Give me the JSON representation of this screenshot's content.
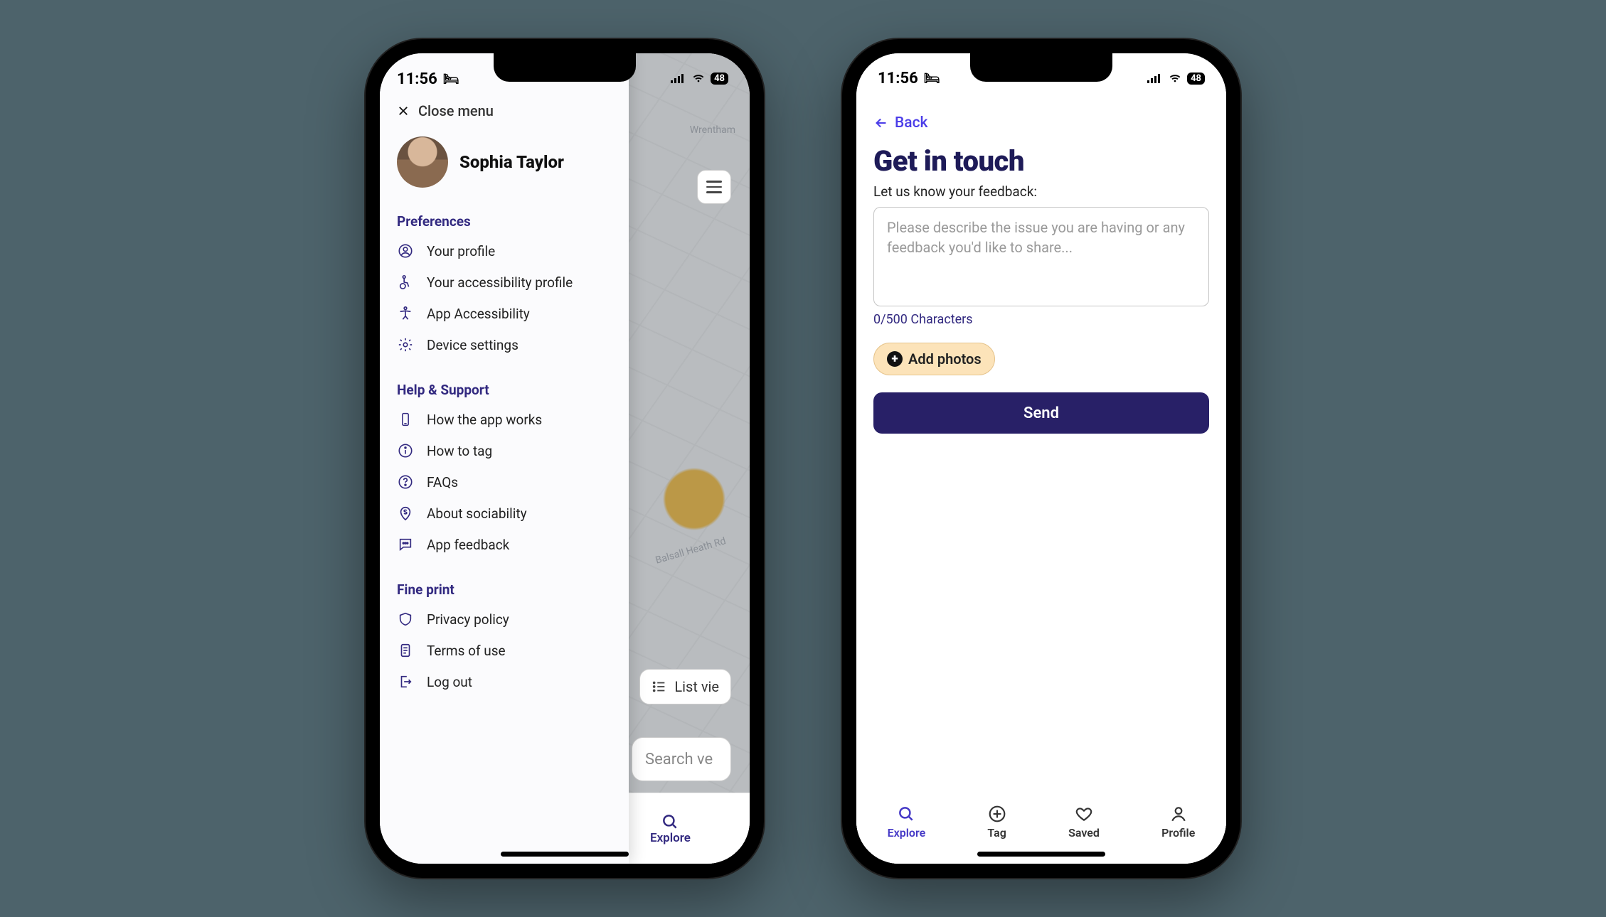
{
  "status": {
    "time": "11:56",
    "battery": "48"
  },
  "drawer": {
    "close_label": "Close menu",
    "user_name": "Sophia Taylor",
    "sections": {
      "preferences": {
        "title": "Preferences",
        "items": [
          {
            "icon": "user-circle-icon",
            "label": "Your profile"
          },
          {
            "icon": "wheelchair-icon",
            "label": "Your accessibility profile"
          },
          {
            "icon": "accessibility-person-icon",
            "label": "App Accessibility"
          },
          {
            "icon": "gear-icon",
            "label": "Device settings"
          }
        ]
      },
      "help": {
        "title": "Help & Support",
        "items": [
          {
            "icon": "phone-icon",
            "label": "How the app works"
          },
          {
            "icon": "info-icon",
            "label": "How to tag"
          },
          {
            "icon": "question-icon",
            "label": "FAQs"
          },
          {
            "icon": "location-s-icon",
            "label": "About sociability"
          },
          {
            "icon": "chat-icon",
            "label": "App feedback"
          }
        ]
      },
      "fineprint": {
        "title": "Fine print",
        "items": [
          {
            "icon": "shield-icon",
            "label": "Privacy policy"
          },
          {
            "icon": "document-icon",
            "label": "Terms of use"
          },
          {
            "icon": "logout-icon",
            "label": "Log out"
          }
        ]
      }
    }
  },
  "map_layer": {
    "list_view_label": "List vie",
    "search_placeholder": "Search ve",
    "street_labels": [
      "Wrentham",
      "Balsall Heath Rd"
    ],
    "nav_explore_label": "Explore"
  },
  "feedback": {
    "back_label": "Back",
    "title": "Get in touch",
    "subtitle": "Let us know your feedback:",
    "placeholder": "Please describe the issue you are having or any feedback you'd like to share...",
    "char_count": "0/500 Characters",
    "add_photos_label": "Add photos",
    "send_label": "Send"
  },
  "bottom_nav": {
    "items": [
      {
        "icon": "search-icon",
        "label": "Explore",
        "active": true
      },
      {
        "icon": "plus-circle-icon",
        "label": "Tag",
        "active": false
      },
      {
        "icon": "heart-icon",
        "label": "Saved",
        "active": false
      },
      {
        "icon": "profile-icon",
        "label": "Profile",
        "active": false
      }
    ]
  }
}
